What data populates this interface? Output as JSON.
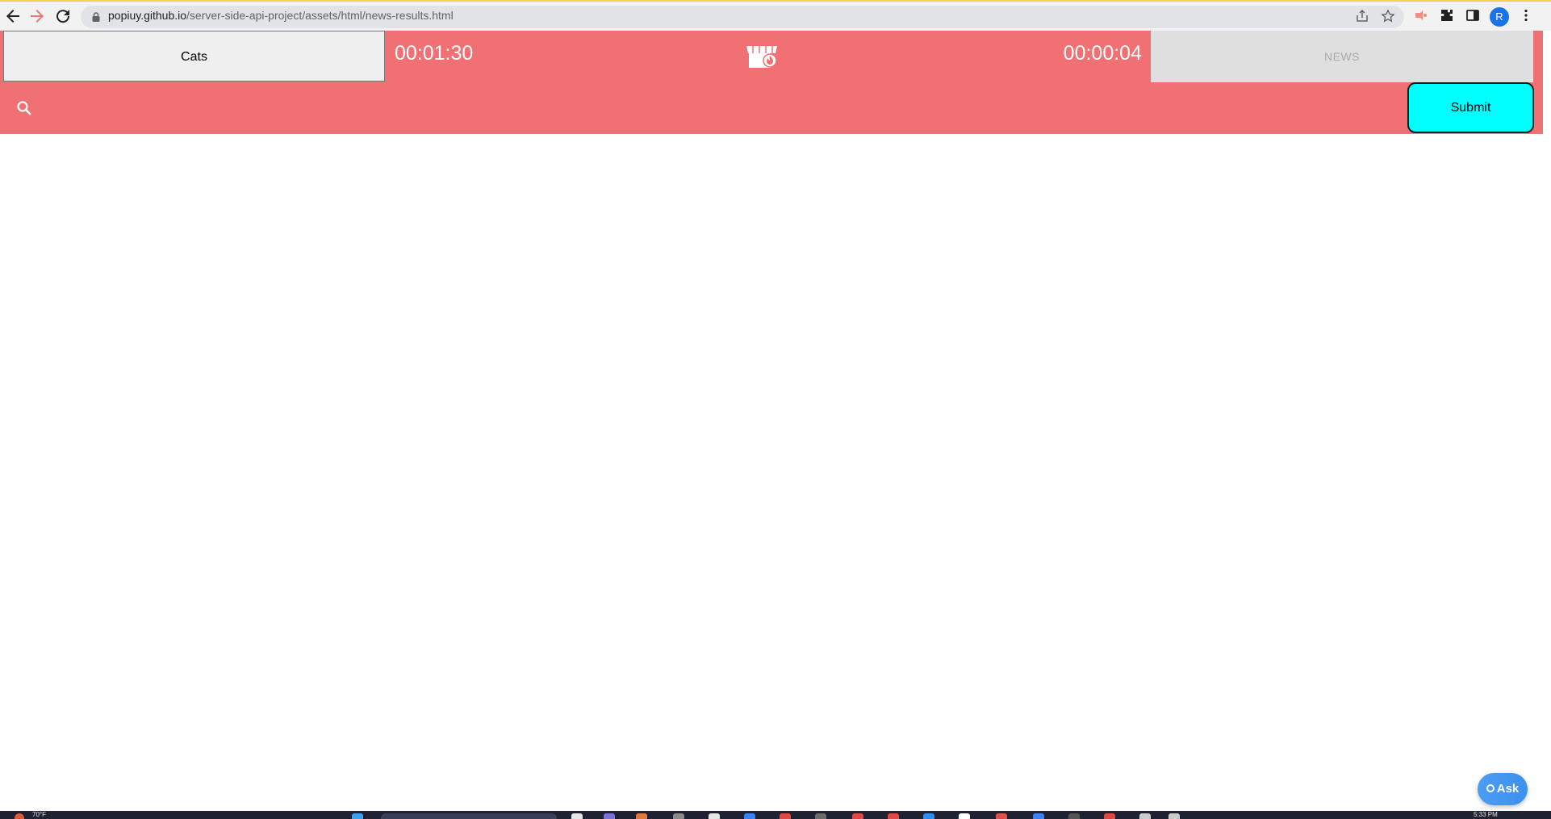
{
  "browser": {
    "url_host": "popiuy.github.io",
    "url_path": "/server-side-api-project/assets/html/news-results.html",
    "profile_initial": "R",
    "icons": [
      "back-arrow-icon",
      "forward-arrow-icon",
      "reload-icon",
      "lock-icon",
      "share-icon",
      "star-icon",
      "extension-icon",
      "puzzle-icon",
      "sidebar-icon",
      "menu-dots-icon"
    ]
  },
  "header": {
    "cats_label": "Cats",
    "timer_left": "00:01:30",
    "timer_right": "00:00:04",
    "news_label": "NEWS",
    "center_icon": "shop-awning-icon",
    "bar_color": "#f07073"
  },
  "search": {
    "placeholder": "",
    "value": "",
    "submit_label": "Submit",
    "submit_color": "#00ffff"
  },
  "ask": {
    "label": "Ask"
  },
  "taskbar": {
    "temp": "70°F",
    "clock": "5:33 PM"
  }
}
